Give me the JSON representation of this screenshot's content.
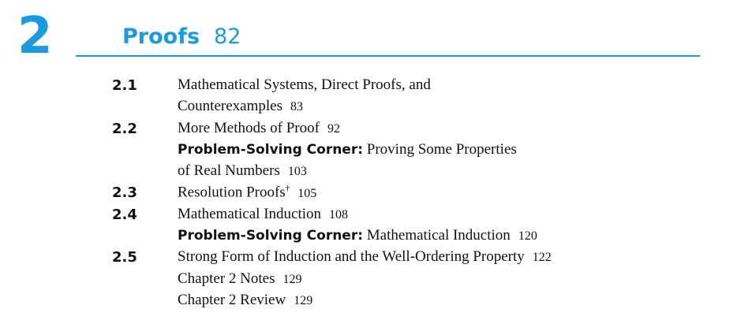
{
  "chapter": {
    "number": "2",
    "title": "Proofs",
    "page": "82"
  },
  "toc": {
    "s1": {
      "num": "2.1",
      "line1": "Mathematical Systems, Direct Proofs, and",
      "line2": "Counterexamples",
      "page": "83"
    },
    "s2": {
      "num": "2.2",
      "title": "More Methods of Proof",
      "page": "92",
      "corner_label": "Problem-Solving Corner:",
      "corner_title_1": "Proving Some Properties",
      "corner_title_2": "of Real Numbers",
      "corner_page": "103"
    },
    "s3": {
      "num": "2.3",
      "title": "Resolution Proofs",
      "mark": "†",
      "page": "105"
    },
    "s4": {
      "num": "2.4",
      "title": "Mathematical Induction",
      "page": "108",
      "corner_label": "Problem-Solving Corner:",
      "corner_title": "Mathematical Induction",
      "corner_page": "120"
    },
    "s5": {
      "num": "2.5",
      "title": "Strong Form of Induction and the Well-Ordering Property",
      "page": "122"
    },
    "notes": {
      "title": "Chapter 2 Notes",
      "page": "129"
    },
    "review": {
      "title": "Chapter 2 Review",
      "page": "129"
    }
  },
  "colors": {
    "accent": "#1a9be0",
    "text": "#111111"
  }
}
